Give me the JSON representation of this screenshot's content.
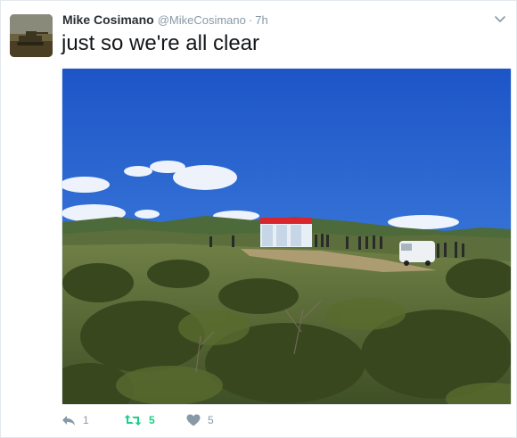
{
  "tweet": {
    "author": {
      "name": "Mike Cosimano",
      "handle": "@MikeCosimano",
      "avatar_icon": "tank-avatar"
    },
    "separator": "·",
    "time": "7h",
    "text": "just so we're all clear",
    "media": {
      "kind": "photo",
      "description_icon": "landscape-photo"
    },
    "actions": {
      "reply_count": "1",
      "retweet_count": "5",
      "like_count": "5"
    },
    "colors": {
      "text": "#14171a",
      "meta": "#8899a6",
      "retweet_active": "#19cf86"
    }
  }
}
